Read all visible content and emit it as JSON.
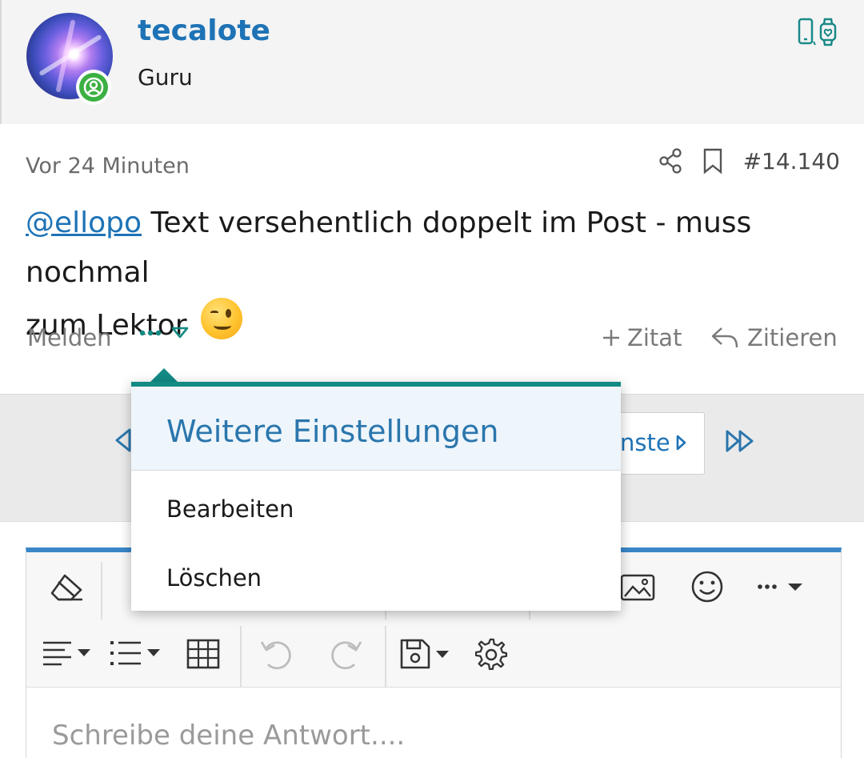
{
  "user": {
    "name": "tecalote",
    "title": "Guru"
  },
  "post": {
    "time": "Vor 24 Minuten",
    "number": "#14.140",
    "mention": "@ellopo",
    "text_line1": " Text versehentlich doppelt im Post - muss nochmal",
    "text_line2": "zum Lektor"
  },
  "footer": {
    "report_label": "Melden",
    "quote_label": "Zitat",
    "reply_label": "Zitieren"
  },
  "pagination": {
    "next_label": "nste"
  },
  "dropdown": {
    "title": "Weitere Einstellungen",
    "items": [
      {
        "label": "Bearbeiten"
      },
      {
        "label": "Löschen"
      }
    ]
  },
  "editor": {
    "placeholder": "Schreibe deine Antwort...."
  },
  "colors": {
    "accent": "#1e73b6",
    "teal": "#138a84",
    "online": "#3cb043",
    "editor_bar": "#3a87c8"
  },
  "icons": [
    "online-user-icon",
    "smartphone-icon",
    "smartwatch-icon",
    "share-icon",
    "bookmark-icon",
    "more-dots-icon",
    "caret-down-icon",
    "plus-icon",
    "reply-arrow-icon",
    "page-prev-icon",
    "page-next-icon",
    "page-last-icon",
    "eraser-icon",
    "image-icon",
    "smiley-icon",
    "align-icon",
    "list-icon",
    "table-icon",
    "undo-icon",
    "redo-icon",
    "save-icon",
    "settings-icon"
  ]
}
